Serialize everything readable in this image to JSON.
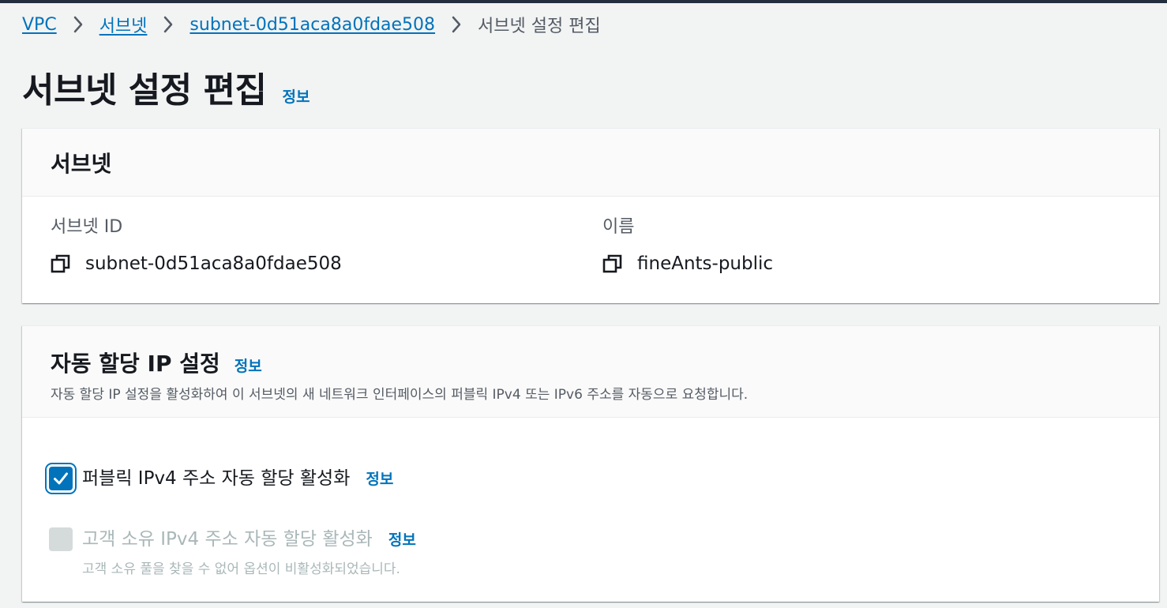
{
  "breadcrumb": {
    "items": [
      "VPC",
      "서브넷",
      "subnet-0d51aca8a0fdae508"
    ],
    "current": "서브넷 설정 편집"
  },
  "page": {
    "title": "서브넷 설정 편집",
    "info": "정보"
  },
  "subnet_panel": {
    "title": "서브넷",
    "fields": [
      {
        "label": "서브넷 ID",
        "value": "subnet-0d51aca8a0fdae508",
        "icon": "copy-icon"
      },
      {
        "label": "이름",
        "value": "fineAnts-public",
        "icon": "copy-icon"
      }
    ]
  },
  "auto_ip_panel": {
    "title": "자동 할당 IP 설정",
    "info": "정보",
    "description": "자동 할당 IP 설정을 활성화하여 이 서브넷의 새 네트워크 인터페이스의 퍼블릭 IPv4 또는 IPv6 주소를 자동으로 요청합니다.",
    "options": [
      {
        "label": "퍼블릭 IPv4 주소 자동 할당 활성화",
        "info": "정보",
        "checked": true,
        "disabled": false
      },
      {
        "label": "고객 소유 IPv4 주소 자동 할당 활성화",
        "info": "정보",
        "checked": false,
        "disabled": true,
        "hint": "고객 소유 풀을 찾을 수 없어 옵션이 비활성화되었습니다."
      }
    ]
  },
  "colors": {
    "link": "#0073bb",
    "text": "#16191f",
    "secondary": "#545b64",
    "disabled": "#aab7b8",
    "background": "#f2f3f3",
    "topbar": "#232f3e"
  }
}
